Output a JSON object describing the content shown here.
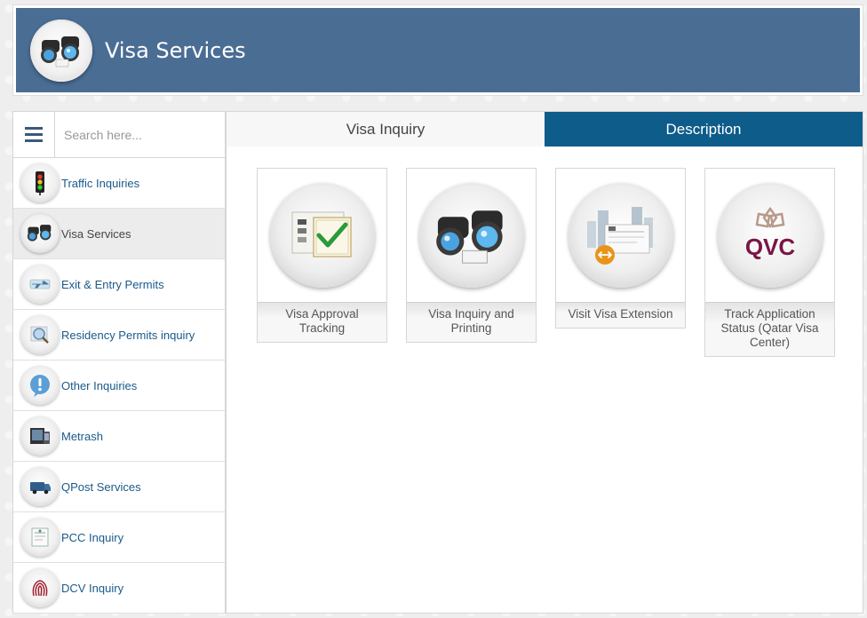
{
  "header": {
    "title": "Visa Services",
    "logo_icon": "binoculars-icon"
  },
  "search": {
    "placeholder": "Search here..."
  },
  "sidebar": {
    "items": [
      {
        "label": "Traffic Inquiries",
        "icon": "traffic-light-icon"
      },
      {
        "label": "Visa Services",
        "icon": "binoculars-icon",
        "active": true
      },
      {
        "label": "Exit & Entry Permits",
        "icon": "airplane-icon"
      },
      {
        "label": "Residency Permits inquiry",
        "icon": "magnifier-icon"
      },
      {
        "label": "Other Inquiries",
        "icon": "exclamation-icon"
      },
      {
        "label": "Metrash",
        "icon": "metrash-icon"
      },
      {
        "label": "QPost Services",
        "icon": "post-van-icon"
      },
      {
        "label": "PCC Inquiry",
        "icon": "certificate-icon"
      },
      {
        "label": "DCV Inquiry",
        "icon": "fingerprint-icon"
      }
    ]
  },
  "tabs": {
    "inquiry": "Visa Inquiry",
    "description": "Description"
  },
  "cards": [
    {
      "label": "Visa Approval Tracking",
      "icon": "approval-check-icon"
    },
    {
      "label": "Visa Inquiry and Printing",
      "icon": "binoculars-icon"
    },
    {
      "label": "Visit Visa Extension",
      "icon": "visa-extension-icon"
    },
    {
      "label": "Track Application Status (Qatar Visa Center)",
      "icon": "qvc-logo-icon",
      "logo_text": "QVC"
    }
  ],
  "colors": {
    "header_bg": "#4a6d94",
    "active_tab": "#0d5c8a",
    "link": "#1a5a8a"
  }
}
